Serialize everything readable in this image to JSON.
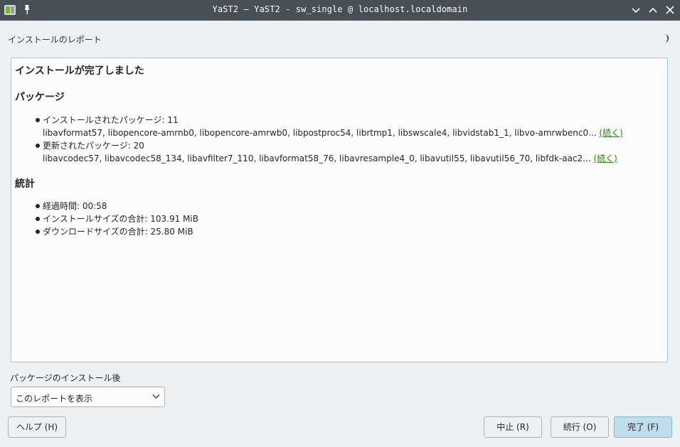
{
  "window": {
    "title": "YaST2 — YaST2 - sw_single @ localhost.localdomain",
    "icons": [
      "yast-app-icon",
      "pin-icon",
      "minimize-icon",
      "maximize-icon",
      "close-icon"
    ]
  },
  "page": {
    "heading": "インストールのレポート",
    "help_toggle_icon": "moon-icon"
  },
  "report": {
    "title": "インストールが完了しました",
    "packages": {
      "heading": "パッケージ",
      "installed": {
        "label": "インストールされたパッケージ: 11",
        "list": "libavformat57, libopencore-amrnb0, libopencore-amrwb0, libpostproc54, librtmp1, libswscale4, libvidstab1_1, libvo-amrwbenc0...",
        "more": "(続く)"
      },
      "updated": {
        "label": "更新されたパッケージ: 20",
        "list": "libavcodec57, libavcodec58_134, libavfilter7_110, libavformat58_76, libavresample4_0, libavutil55, libavutil56_70, libfdk-aac2...",
        "more": "(続く)"
      }
    },
    "stats": {
      "heading": "統計",
      "items": [
        "経過時間: 00:58",
        "インストールサイズの合計: 103.91 MiB",
        "ダウンロードサイズの合計: 25.80 MiB"
      ]
    }
  },
  "after_install": {
    "label": "パッケージのインストール後",
    "selected": "このレポートを表示"
  },
  "buttons": {
    "help": "ヘルプ (H)",
    "abort": "中止 (R)",
    "continue": "続行 (O)",
    "finish": "完了 (F)"
  },
  "colors": {
    "titlebar": "#475057",
    "panel_border": "#93cee9",
    "link": "#2c7a19",
    "primary_button": "#c1dcea"
  }
}
